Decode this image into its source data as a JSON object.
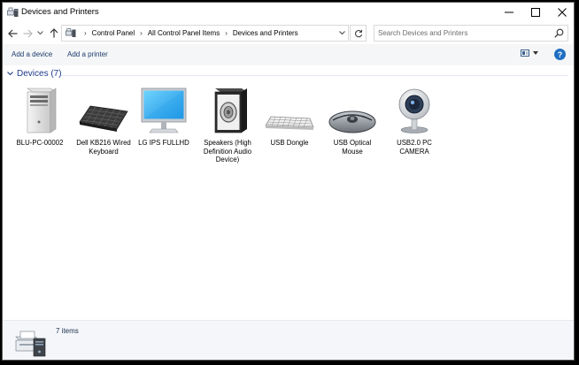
{
  "window": {
    "title": "Devices and Printers"
  },
  "address": {
    "breadcrumbs": [
      "Control Panel",
      "All Control Panel Items",
      "Devices and Printers"
    ]
  },
  "search": {
    "placeholder": "Search Devices and Printers"
  },
  "commands": {
    "add_device": "Add a device",
    "add_printer": "Add a printer"
  },
  "help": {
    "glyph": "?"
  },
  "group": {
    "label": "Devices (7)"
  },
  "devices": [
    {
      "label": "BLU-PC-00002",
      "icon": "computer-tower-icon"
    },
    {
      "label": "Dell KB216 Wired Keyboard",
      "icon": "keyboard-icon"
    },
    {
      "label": "LG IPS FULLHD",
      "icon": "monitor-icon"
    },
    {
      "label": "Speakers (High Definition Audio Device)",
      "icon": "speaker-icon"
    },
    {
      "label": "USB Dongle",
      "icon": "keyboard-icon"
    },
    {
      "label": "USB Optical Mouse",
      "icon": "mouse-icon"
    },
    {
      "label": "USB2.0 PC CAMERA",
      "icon": "webcam-icon"
    }
  ],
  "status": {
    "count_text": "7 items"
  },
  "colors": {
    "accent": "#1e3a8a",
    "command_text": "#1a3b6b",
    "help_blue": "#1f6fc2"
  }
}
